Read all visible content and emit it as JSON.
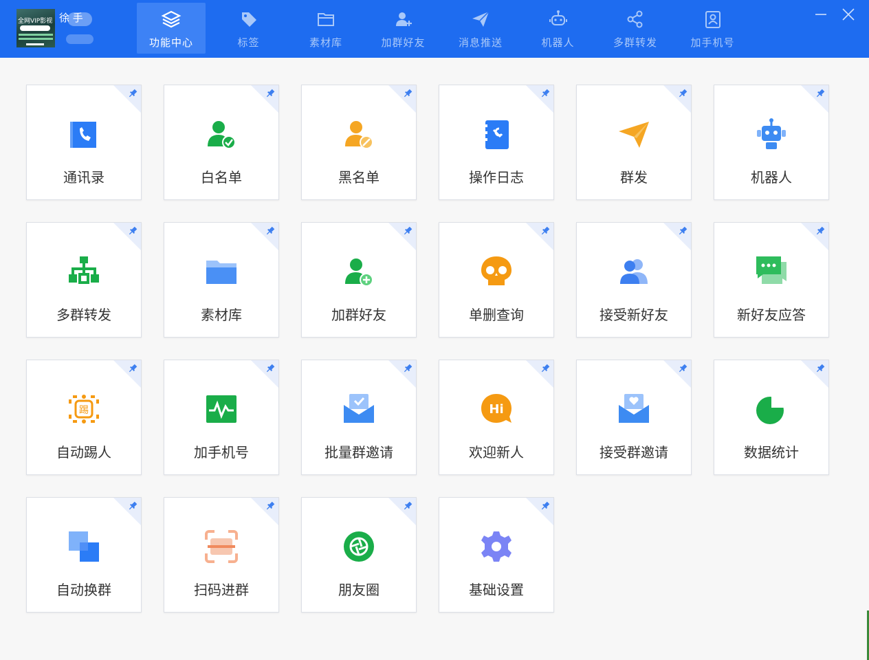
{
  "user": {
    "name": "徐 手",
    "avatar_text": "全网VIP影视"
  },
  "nav_tabs": [
    {
      "label": "功能中心",
      "icon": "layers-icon",
      "active": true
    },
    {
      "label": "标签",
      "icon": "tag-icon",
      "active": false
    },
    {
      "label": "素材库",
      "icon": "folder-icon",
      "active": false
    },
    {
      "label": "加群好友",
      "icon": "add-user-icon",
      "active": false
    },
    {
      "label": "消息推送",
      "icon": "paper-plane-icon",
      "active": false
    },
    {
      "label": "机器人",
      "icon": "robot-icon",
      "active": false
    },
    {
      "label": "多群转发",
      "icon": "share-icon",
      "active": false
    },
    {
      "label": "加手机号",
      "icon": "contact-card-icon",
      "active": false
    }
  ],
  "window": {
    "minimize": "minimize-icon",
    "close": "close-icon"
  },
  "cards": [
    {
      "label": "通讯录",
      "icon": "contacts-book-icon",
      "color": "#2b7cf6"
    },
    {
      "label": "白名单",
      "icon": "user-check-icon",
      "color": "#1aad49"
    },
    {
      "label": "黑名单",
      "icon": "user-block-icon",
      "color": "#f5a623"
    },
    {
      "label": "操作日志",
      "icon": "log-book-icon",
      "color": "#2b7cf6"
    },
    {
      "label": "群发",
      "icon": "paper-plane-icon",
      "color": "#f5a623"
    },
    {
      "label": "机器人",
      "icon": "robot-icon",
      "color": "#3d8bf2"
    },
    {
      "label": "多群转发",
      "icon": "org-chart-icon",
      "color": "#1aad49"
    },
    {
      "label": "素材库",
      "icon": "folder-icon",
      "color": "#4a90f5"
    },
    {
      "label": "加群好友",
      "icon": "user-add-icon",
      "color": "#1aad49"
    },
    {
      "label": "单删查询",
      "icon": "skull-icon",
      "color": "#f59a12"
    },
    {
      "label": "接受新好友",
      "icon": "user-group-icon",
      "color": "#3d7ff0"
    },
    {
      "label": "新好友应答",
      "icon": "chat-bubble-icon",
      "color": "#2ebc5c"
    },
    {
      "label": "自动踢人",
      "icon": "kick-icon",
      "color": "#f59a12",
      "glyph": "踢"
    },
    {
      "label": "加手机号",
      "icon": "pulse-monitor-icon",
      "color": "#1aad49"
    },
    {
      "label": "批量群邀请",
      "icon": "mail-check-icon",
      "color": "#3d8bf2"
    },
    {
      "label": "欢迎新人",
      "icon": "hi-bubble-icon",
      "color": "#f59a12",
      "glyph": "Hi"
    },
    {
      "label": "接受群邀请",
      "icon": "mail-heart-icon",
      "color": "#3d8bf2"
    },
    {
      "label": "数据统计",
      "icon": "pie-chart-icon",
      "color": "#1aad49"
    },
    {
      "label": "自动换群",
      "icon": "swap-squares-icon",
      "color": "#2b7cf6"
    },
    {
      "label": "扫码进群",
      "icon": "scan-icon",
      "color": "#f08a5d"
    },
    {
      "label": "朋友圈",
      "icon": "camera-shutter-icon",
      "color": "#1aad49"
    },
    {
      "label": "基础设置",
      "icon": "gear-icon",
      "color": "#7b84f5"
    }
  ]
}
